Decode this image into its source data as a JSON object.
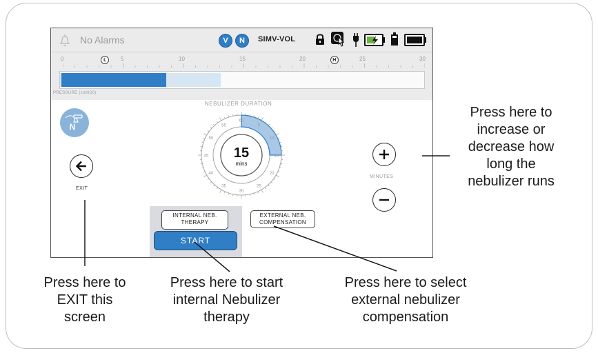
{
  "topbar": {
    "alarm_text": "No Alarms",
    "badges": [
      "V",
      "N"
    ],
    "mode": "SIMV-VOL",
    "status_icons": [
      "lock-icon",
      "touch-icon",
      "plug-icon",
      "battery-charging-icon",
      "battery-small-icon",
      "battery-full-icon"
    ]
  },
  "scale": {
    "ticks": [
      "0",
      "5",
      "10",
      "15",
      "20",
      "25",
      "30"
    ],
    "low_marker": "L",
    "high_marker": "H",
    "low_marker_value": 3.5,
    "high_marker_value": 22.5,
    "pressure_value": 8.5,
    "target_value": 13,
    "pressure_label": "PRESSURE (cmH20)"
  },
  "nebulizer": {
    "icon_letter": "N",
    "duration_title": "NEBULIZER DURATION",
    "duration_value": "15",
    "duration_unit": "mins",
    "dial_labels": [
      "60",
      "5",
      "10",
      "15",
      "20",
      "25",
      "30",
      "35",
      "40",
      "45",
      "50",
      "55"
    ],
    "dial_fraction": 0.25,
    "internal_label_line1": "INTERNAL NEB.",
    "internal_label_line2": "THERAPY",
    "external_label_line1": "EXTERNAL NEB.",
    "external_label_line2": "COMPENSATION",
    "start_label": "START"
  },
  "controls": {
    "exit_label": "EXIT",
    "minutes_label": "MINUTES"
  },
  "callouts": {
    "exit": [
      "Press here to",
      "EXIT this",
      "screen"
    ],
    "start": [
      "Press here to start",
      "internal Nebulizer",
      "therapy"
    ],
    "external": [
      "Press here to select",
      "external nebulizer",
      "compensation"
    ],
    "minutes": [
      "Press here to",
      "increase or",
      "decrease how",
      "long the",
      "nebulizer runs"
    ]
  },
  "colors": {
    "accent": "#2f7ec6",
    "bar_light": "#d6e6f3",
    "dial_fill": "#a8c8e6",
    "panel": "#d9dbe0"
  }
}
